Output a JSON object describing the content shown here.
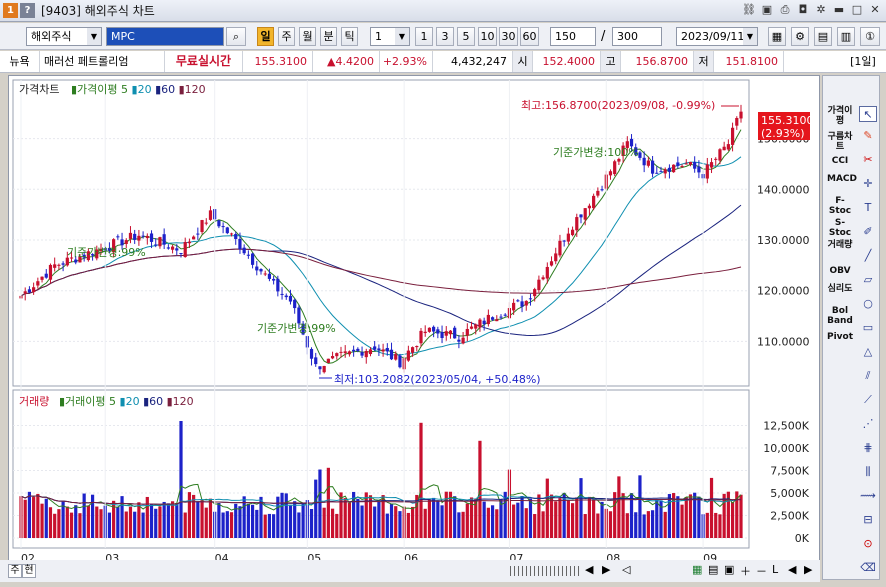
{
  "window": {
    "badge1": "1",
    "badge2": "?",
    "title": "[9403] 해외주식 차트"
  },
  "toolbar": {
    "market_select": "해외주식",
    "symbol": "MPC",
    "periods": [
      "일",
      "주",
      "월",
      "분",
      "틱"
    ],
    "active_period": "일",
    "interval_select": "1",
    "interval_buttons": [
      "1",
      "3",
      "5",
      "10",
      "30",
      "60"
    ],
    "count": "150",
    "count_sep": "/",
    "max_count": "300",
    "date": "2023/09/11"
  },
  "quote": {
    "exchange": "뉴욕",
    "name": "매러선 페트롤리엄",
    "realtime_label": "무료실시간",
    "price": "155.3100",
    "change": "▲4.4200",
    "change_pct": "+2.93%",
    "volume": "4,432,247",
    "open_label": "시",
    "open": "152.4000",
    "high_label": "고",
    "high": "156.8700",
    "low_label": "저",
    "low": "151.8100",
    "period_tag": "[1일]"
  },
  "price_panel": {
    "title": "가격차트",
    "legend": [
      {
        "label": "가격이평 5",
        "color": "#2e7d20"
      },
      {
        "label": "20",
        "color": "#0f8fb0"
      },
      {
        "label": "60",
        "color": "#1a237e"
      },
      {
        "label": "120",
        "color": "#7a1f3d"
      }
    ],
    "y_ticks": [
      "150.0000",
      "140.0000",
      "130.0000",
      "120.0000",
      "110.0000"
    ],
    "current_price": "155.3100",
    "current_pct": "(2.93%)",
    "high_annotation": "최고:156.8700(2023/09/08, -0.99%)",
    "low_annotation": "최저:103.2082(2023/05/04, +50.48%)",
    "split_notes": [
      "기준가변경:99%",
      "기준가변경:99%",
      "기준가변경:100%"
    ]
  },
  "volume_panel": {
    "title": "거래량",
    "legend": [
      {
        "label": "거래이평 5",
        "color": "#2e7d20"
      },
      {
        "label": "20",
        "color": "#0f8fb0"
      },
      {
        "label": "60",
        "color": "#1a237e"
      },
      {
        "label": "120",
        "color": "#7a1f3d"
      }
    ],
    "y_ticks": [
      "12,500K",
      "10,000K",
      "7,500K",
      "5,000K",
      "2,500K",
      "0K"
    ]
  },
  "x_axis": [
    "02",
    "03",
    "04",
    "05",
    "06",
    "07",
    "08",
    "09"
  ],
  "sidebar": {
    "text_items": [
      "가격이평",
      "구름차트",
      "CCI",
      "MACD",
      "F-Stoc",
      "S-Stoc",
      "거래량",
      "OBV",
      "심리도",
      "Bol Band",
      "Pivot"
    ]
  },
  "bottom": {
    "labels": [
      "주",
      "현"
    ]
  },
  "colors": {
    "up": "#c8102e",
    "down": "#1d22c9",
    "ma5": "#2e7d20",
    "ma20": "#0f8fb0",
    "ma60": "#1a237e",
    "ma120": "#7a1f3d"
  },
  "chart_data": {
    "type": "candlestick",
    "price_range": [
      102,
      158
    ],
    "volume_range_k": [
      0,
      14000
    ],
    "x_months": [
      "02",
      "03",
      "04",
      "05",
      "06",
      "07",
      "08",
      "09"
    ],
    "close_keypoints": [
      [
        0,
        119
      ],
      [
        8,
        125
      ],
      [
        18,
        128
      ],
      [
        28,
        131
      ],
      [
        38,
        128
      ],
      [
        45,
        135
      ],
      [
        52,
        129
      ],
      [
        60,
        121
      ],
      [
        64,
        118
      ],
      [
        70,
        105
      ],
      [
        76,
        107
      ],
      [
        84,
        109
      ],
      [
        90,
        106
      ],
      [
        96,
        112
      ],
      [
        104,
        111
      ],
      [
        112,
        115
      ],
      [
        120,
        118
      ],
      [
        130,
        132
      ],
      [
        138,
        141
      ],
      [
        144,
        149
      ],
      [
        150,
        144
      ],
      [
        158,
        145
      ],
      [
        162,
        143
      ],
      [
        168,
        149
      ],
      [
        171,
        155.31
      ]
    ],
    "annotations": {
      "high": "156.8700",
      "high_date": "2023/09/08",
      "low": "103.2082",
      "low_date": "2023/05/04"
    }
  }
}
